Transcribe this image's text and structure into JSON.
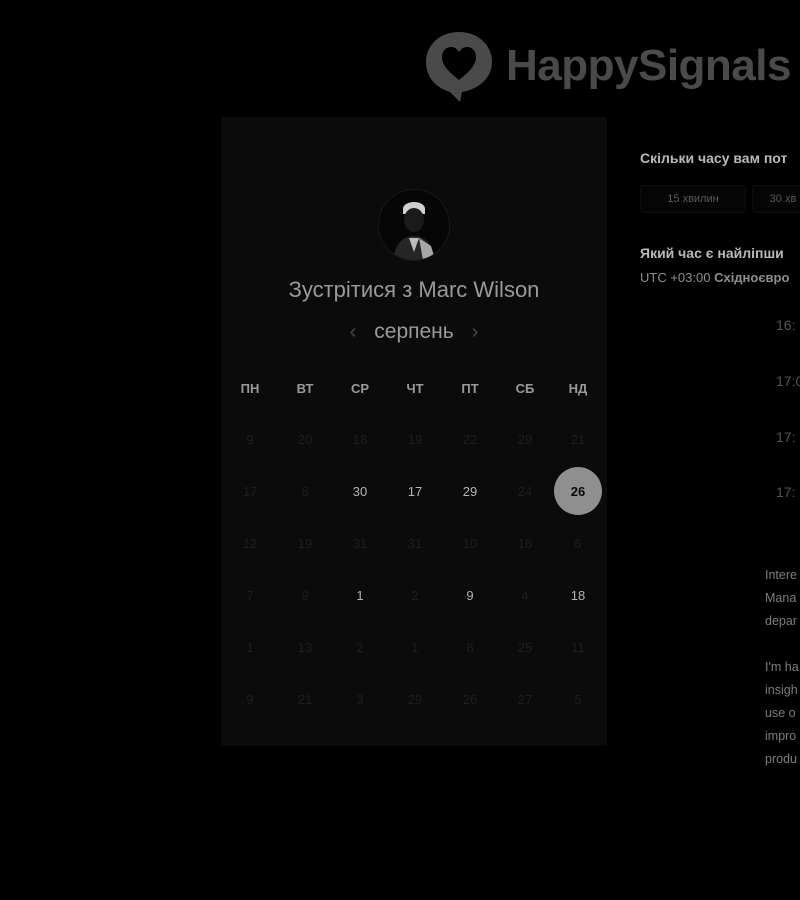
{
  "brand": {
    "name": "HappySignals"
  },
  "booking": {
    "title_prefix": "Зустрітися з",
    "host_name": "Marc Wilson",
    "month": "серпень",
    "weekdays": [
      "ПН",
      "ВТ",
      "СР",
      "ЧТ",
      "ПТ",
      "СБ",
      "НД"
    ],
    "days": [
      [
        "9",
        "20",
        "18",
        "19",
        "22",
        "29",
        "21"
      ],
      [
        "17",
        "6",
        "30",
        "17",
        "29",
        "24",
        "26"
      ],
      [
        "12",
        "19",
        "31",
        "31",
        "10",
        "16",
        "6"
      ],
      [
        "7",
        "9",
        "1",
        "2",
        "9",
        "4",
        "18"
      ],
      [
        "1",
        "13",
        "2",
        "1",
        "8",
        "25",
        "11"
      ],
      [
        "9",
        "21",
        "3",
        "29",
        "26",
        "27",
        "5"
      ]
    ],
    "available": [
      [
        1,
        2
      ],
      [
        1,
        3
      ],
      [
        1,
        4
      ],
      [
        1,
        6
      ],
      [
        3,
        2
      ],
      [
        3,
        4
      ],
      [
        3,
        6
      ]
    ],
    "selected": [
      1,
      6
    ]
  },
  "details": {
    "duration_question": "Скільки часу вам пот",
    "durations": [
      "15 хвилин",
      "30 хв"
    ],
    "time_question": "Який час є найліпши",
    "timezone_offset": "UTC +03:00",
    "timezone_name": "Східноєвро",
    "slots": [
      "16:",
      "17:0",
      "17:",
      "17:"
    ],
    "description_p1": [
      "Intere",
      "Mana",
      "depar"
    ],
    "description_p2": [
      "I'm ha",
      "insigh",
      "use o",
      "impro",
      "produ"
    ]
  },
  "colors": {
    "background": "#000000",
    "panel": "#0b0b0b",
    "selected_day": "#8f8f8f",
    "logo": "#4a4a4a"
  }
}
